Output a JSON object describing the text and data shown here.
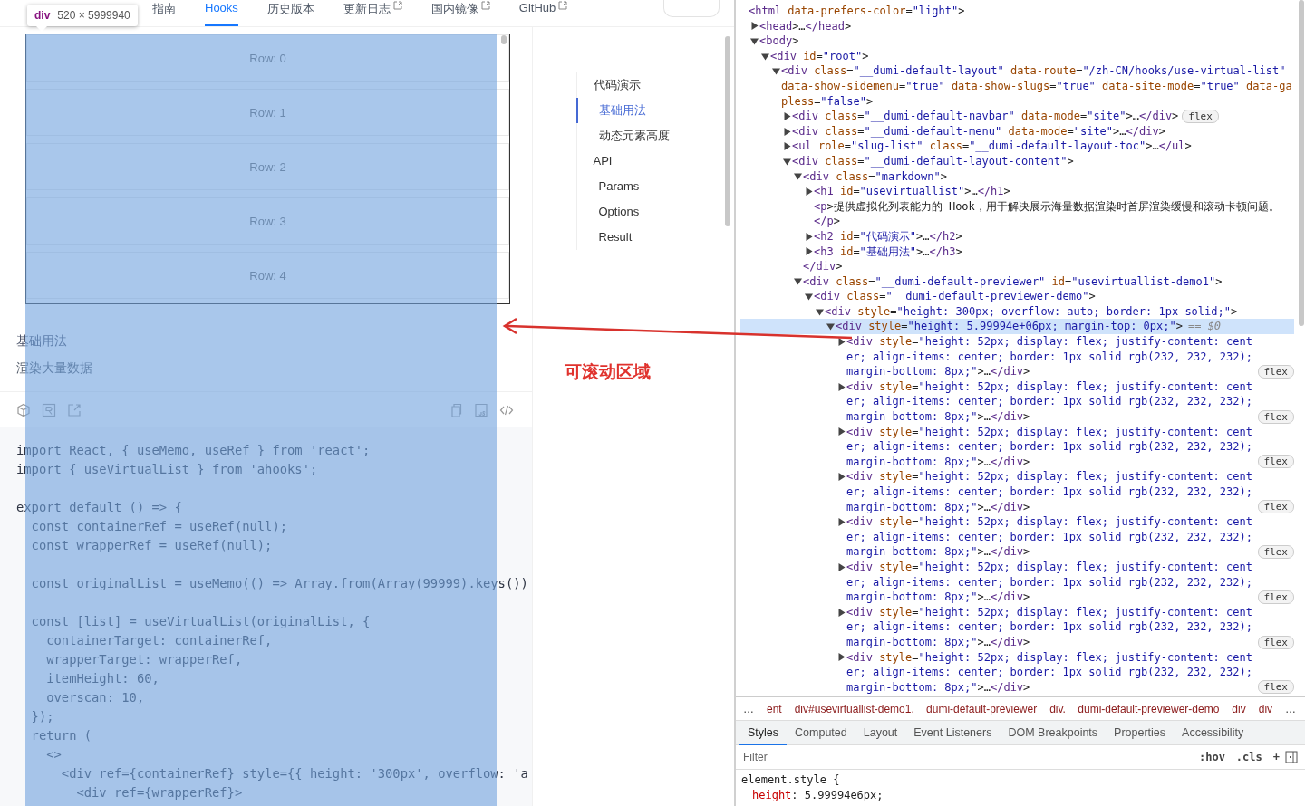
{
  "site_nav": {
    "items": [
      {
        "label": "指南",
        "selected": false,
        "external": false
      },
      {
        "label": "Hooks",
        "selected": true,
        "external": false
      },
      {
        "label": "历史版本",
        "selected": false,
        "external": false
      },
      {
        "label": "更新日志",
        "selected": false,
        "external": true
      },
      {
        "label": "国内镜像",
        "selected": false,
        "external": true
      },
      {
        "label": "GitHub",
        "selected": false,
        "external": true
      }
    ]
  },
  "inspect_tooltip": {
    "tag": "div",
    "size": "520 × 5999940"
  },
  "demo": {
    "rows": [
      "Row: 0",
      "Row: 1",
      "Row: 2",
      "Row: 3",
      "Row: 4"
    ]
  },
  "section": {
    "title": "基础用法",
    "description": "渲染大量数据"
  },
  "code_blocks": [
    [
      "import React, { useMemo, useRef } from 'react';",
      "import { useVirtualList } from 'ahooks';"
    ],
    [
      "export default () => {",
      "  const containerRef = useRef(null);",
      "  const wrapperRef = useRef(null);"
    ],
    [
      "  const originalList = useMemo(() => Array.from(Array(99999).keys())"
    ],
    [
      "  const [list] = useVirtualList(originalList, {",
      "    containerTarget: containerRef,",
      "    wrapperTarget: wrapperRef,",
      "    itemHeight: 60,",
      "    overscan: 10,",
      "  });",
      "  return (",
      "    <>",
      "      <div ref={containerRef} style={{ height: '300px', overflow: 'a",
      "        <div ref={wrapperRef}>"
    ]
  ],
  "toc": {
    "items": [
      {
        "label": "代码演示",
        "selected": false,
        "children": [
          {
            "label": "基础用法",
            "selected": true
          },
          {
            "label": "动态元素高度",
            "selected": false
          }
        ]
      },
      {
        "label": "API",
        "selected": false,
        "children": [
          {
            "label": "Params",
            "selected": false
          },
          {
            "label": "Options",
            "selected": false
          },
          {
            "label": "Result",
            "selected": false
          }
        ]
      }
    ]
  },
  "annotation": {
    "label": "可滚动区域"
  },
  "devtools": {
    "tree": [
      {
        "text": "<html data-prefers-color=\"light\">",
        "expandable": false,
        "selected": false,
        "children": [
          {
            "text": "<head>…</head>",
            "expandable": true,
            "expanded": false,
            "selected": false
          },
          {
            "text": "<body>",
            "expandable": true,
            "expanded": true,
            "selected": false,
            "children": [
              {
                "text": "<div id=\"root\">",
                "expandable": true,
                "expanded": true,
                "selected": false,
                "children": [
                  {
                    "text": "<div class=\"__dumi-default-layout\" data-route=\"/zh-CN/hooks/use-virtual-list\" data-show-sidemenu=\"true\" data-show-slugs=\"true\" data-site-mode=\"true\" data-gapless=\"false\">",
                    "expandable": true,
                    "expanded": true,
                    "selected": false,
                    "children": [
                      {
                        "text": "<div class=\"__dumi-default-navbar\" data-mode=\"site\">…</div>",
                        "expandable": true,
                        "expanded": false,
                        "selected": false,
                        "badge": "flex"
                      },
                      {
                        "text": "<div class=\"__dumi-default-menu\" data-mode=\"site\">…</div>",
                        "expandable": true,
                        "expanded": false,
                        "selected": false
                      },
                      {
                        "text": "<ul role=\"slug-list\" class=\"__dumi-default-layout-toc\">…</ul>",
                        "expandable": true,
                        "expanded": false,
                        "selected": false
                      },
                      {
                        "text": "<div class=\"__dumi-default-layout-content\">",
                        "expandable": true,
                        "expanded": true,
                        "selected": false,
                        "children": [
                          {
                            "text": "<div class=\"markdown\">",
                            "expandable": true,
                            "expanded": true,
                            "selected": false,
                            "children": [
                              {
                                "text": "<h1 id=\"usevirtuallist\">…</h1>",
                                "expandable": true,
                                "expanded": false,
                                "selected": false
                              },
                              {
                                "text": "<p>提供虚拟化列表能力的 Hook，用于解决展示海量数据渲染时首屏渲染缓慢和滚动卡顿问题。",
                                "expandable": false,
                                "selected": false
                              },
                              {
                                "text": "</p>",
                                "expandable": false,
                                "selected": false
                              },
                              {
                                "text": "<h2 id=\"代码演示\">…</h2>",
                                "expandable": true,
                                "expanded": false,
                                "selected": false
                              },
                              {
                                "text": "<h3 id=\"基础用法\">…</h3>",
                                "expandable": true,
                                "expanded": false,
                                "selected": false
                              }
                            ]
                          },
                          {
                            "text": "</div>",
                            "expandable": false,
                            "selected": false
                          },
                          {
                            "text": "<div class=\"__dumi-default-previewer\" id=\"usevirtuallist-demo1\">",
                            "expandable": true,
                            "expanded": true,
                            "selected": false,
                            "children": [
                              {
                                "text": "<div class=\"__dumi-default-previewer-demo\">",
                                "expandable": true,
                                "expanded": true,
                                "selected": false,
                                "children": [
                                  {
                                    "text": "<div style=\"height: 300px; overflow: auto; border: 1px solid;\">",
                                    "expandable": true,
                                    "expanded": true,
                                    "selected": false,
                                    "children": [
                                      {
                                        "text": "<div style=\"height: 5.99994e+06px; margin-top: 0px;\">",
                                        "expandable": true,
                                        "expanded": true,
                                        "selected": true,
                                        "suffix": "== $0",
                                        "children": [
                                          {
                                            "text": "<div style=\"height: 52px; display: flex; justify-content: center; align-items: center; border: 1px solid rgb(232, 232, 232); margin-bottom: 8px;\">…</div>",
                                            "expandable": true,
                                            "expanded": false,
                                            "selected": false,
                                            "badge": "flex"
                                          },
                                          {
                                            "text": "<div style=\"height: 52px; display: flex; justify-content: center; align-items: center; border: 1px solid rgb(232, 232, 232); margin-bottom: 8px;\">…</div>",
                                            "expandable": true,
                                            "expanded": false,
                                            "selected": false,
                                            "badge": "flex"
                                          },
                                          {
                                            "text": "<div style=\"height: 52px; display: flex; justify-content: center; align-items: center; border: 1px solid rgb(232, 232, 232); margin-bottom: 8px;\">…</div>",
                                            "expandable": true,
                                            "expanded": false,
                                            "selected": false,
                                            "badge": "flex"
                                          },
                                          {
                                            "text": "<div style=\"height: 52px; display: flex; justify-content: center; align-items: center; border: 1px solid rgb(232, 232, 232); margin-bottom: 8px;\">…</div>",
                                            "expandable": true,
                                            "expanded": false,
                                            "selected": false,
                                            "badge": "flex"
                                          },
                                          {
                                            "text": "<div style=\"height: 52px; display: flex; justify-content: center; align-items: center; border: 1px solid rgb(232, 232, 232); margin-bottom: 8px;\">…</div>",
                                            "expandable": true,
                                            "expanded": false,
                                            "selected": false,
                                            "badge": "flex"
                                          },
                                          {
                                            "text": "<div style=\"height: 52px; display: flex; justify-content: center; align-items: center; border: 1px solid rgb(232, 232, 232); margin-bottom: 8px;\">…</div>",
                                            "expandable": true,
                                            "expanded": false,
                                            "selected": false,
                                            "badge": "flex"
                                          },
                                          {
                                            "text": "<div style=\"height: 52px; display: flex; justify-content: center; align-items: center; border: 1px solid rgb(232, 232, 232); margin-bottom: 8px;\">…</div>",
                                            "expandable": true,
                                            "expanded": false,
                                            "selected": false,
                                            "badge": "flex"
                                          },
                                          {
                                            "text": "<div style=\"height: 52px; display: flex; justify-content: center; align-items: center; border: 1px solid rgb(232, 232, 232); margin-bottom: 8px;\">…</div>",
                                            "expandable": true,
                                            "expanded": false,
                                            "selected": false,
                                            "badge": "flex"
                                          }
                                        ]
                                      }
                                    ]
                                  }
                                ]
                              }
                            ]
                          }
                        ]
                      }
                    ]
                  }
                ]
              }
            ]
          }
        ]
      }
    ],
    "breadcrumbs": [
      "…",
      "ent",
      "div#usevirtuallist-demo1.__dumi-default-previewer",
      "div.__dumi-default-previewer-demo",
      "div",
      "div",
      "…"
    ],
    "tabs": [
      {
        "label": "Styles",
        "selected": true
      },
      {
        "label": "Computed",
        "selected": false
      },
      {
        "label": "Layout",
        "selected": false
      },
      {
        "label": "Event Listeners",
        "selected": false
      },
      {
        "label": "DOM Breakpoints",
        "selected": false
      },
      {
        "label": "Properties",
        "selected": false
      },
      {
        "label": "Accessibility",
        "selected": false
      }
    ],
    "filter": {
      "placeholder": "Filter"
    },
    "filter_buttons": [
      ":hov",
      ".cls",
      "+"
    ],
    "styles": {
      "selector": "element.style {",
      "declarations": [
        "height: 5.99994e6px;"
      ]
    }
  }
}
